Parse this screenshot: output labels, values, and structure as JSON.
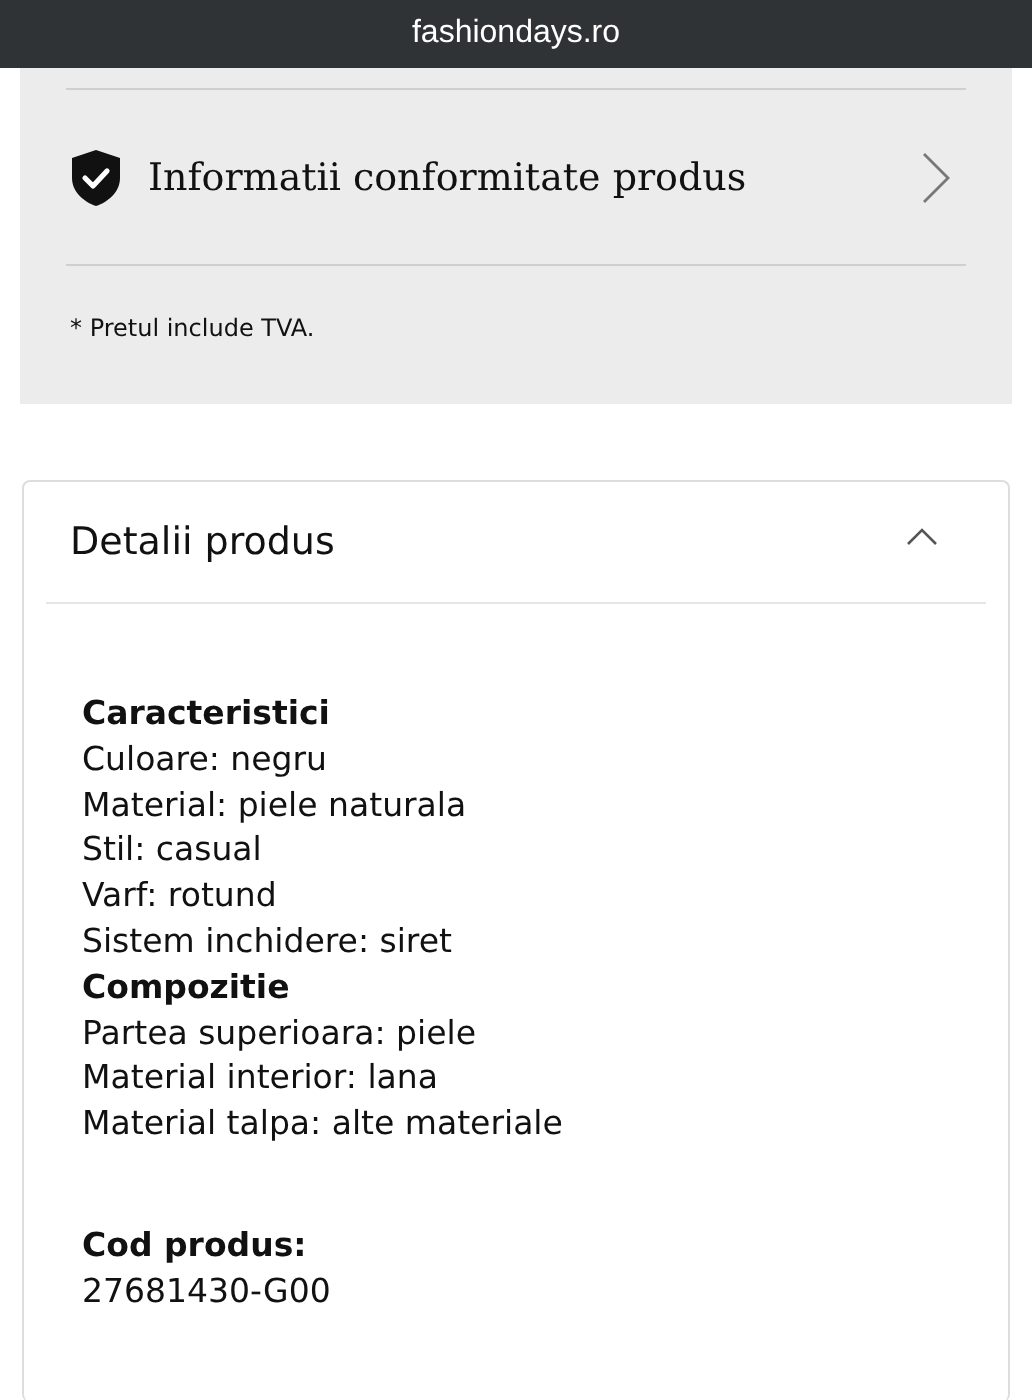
{
  "address_bar": {
    "url": "fashiondays.ro"
  },
  "info_panel": {
    "compliance_link": "Informatii conformitate produs",
    "note": "* Pretul include TVA."
  },
  "details": {
    "title": "Detalii produs",
    "expanded": true,
    "groups": [
      {
        "lines": [
          {
            "kind": "heading",
            "text": "Caracteristici"
          },
          {
            "kind": "line",
            "text": "Culoare: negru"
          },
          {
            "kind": "line",
            "text": "Material: piele naturala"
          },
          {
            "kind": "line",
            "text": "Stil: casual"
          },
          {
            "kind": "line",
            "text": "Varf: rotund"
          },
          {
            "kind": "line",
            "text": "Sistem inchidere: siret"
          },
          {
            "kind": "heading",
            "text": "Compozitie"
          },
          {
            "kind": "line",
            "text": "Partea superioara: piele"
          },
          {
            "kind": "line",
            "text": "Material interior: lana"
          },
          {
            "kind": "line",
            "text": "Material talpa: alte materiale"
          }
        ]
      },
      {
        "lines": [
          {
            "kind": "heading",
            "text": "Cod produs:"
          },
          {
            "kind": "line",
            "text": "27681430-G00"
          }
        ]
      }
    ]
  }
}
